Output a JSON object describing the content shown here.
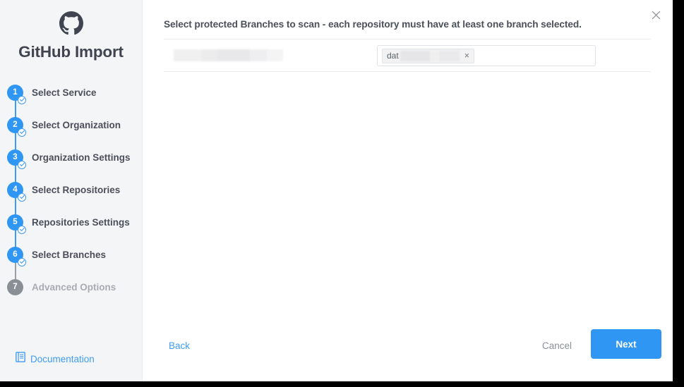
{
  "sidebar": {
    "brand_title": "GitHub Import",
    "logo_icon": "github-octocat-icon",
    "steps": [
      {
        "number": "1",
        "label": "Select Service",
        "completed": true
      },
      {
        "number": "2",
        "label": "Select Organization",
        "completed": true
      },
      {
        "number": "3",
        "label": "Organization Settings",
        "completed": true
      },
      {
        "number": "4",
        "label": "Select Repositories",
        "completed": true
      },
      {
        "number": "5",
        "label": "Repositories Settings",
        "completed": true
      },
      {
        "number": "6",
        "label": "Select Branches",
        "completed": true
      },
      {
        "number": "7",
        "label": "Advanced Options",
        "completed": false
      }
    ],
    "documentation": {
      "label": "Documentation",
      "icon": "book-icon"
    }
  },
  "main": {
    "close_icon": "close-icon",
    "heading": "Select protected Branches to scan - each repository must have at least one branch selected.",
    "rows": [
      {
        "repository_name": "",
        "branch_chip": {
          "visible_text": "dat",
          "remove_label": "×"
        }
      }
    ]
  },
  "footer": {
    "back_label": "Back",
    "cancel_label": "Cancel",
    "next_label": "Next"
  },
  "colors": {
    "accent_blue": "#2f96f3",
    "link_blue": "#3f9cf5",
    "sidebar_bg": "#f4f5f7",
    "text_dark": "#4a4f5a",
    "text_muted": "#a7abb2"
  }
}
